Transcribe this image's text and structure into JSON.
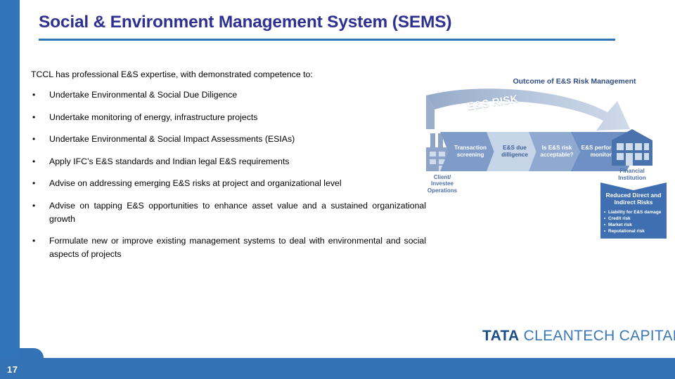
{
  "slide": {
    "title": "Social & Environment Management System (SEMS)",
    "page_number": "17",
    "accent_color": "#3274b8",
    "title_color": "#2e3192",
    "rule_color": "#2e75b6"
  },
  "body": {
    "lead": "TCCL has professional E&S expertise, with demonstrated competence to:",
    "bullet_marker": "•",
    "bullets": [
      "Undertake Environmental & Social Due Diligence",
      "Undertake monitoring of energy, infrastructure projects",
      "Undertake Environmental & Social Impact Assessments (ESIAs)",
      "Apply IFC’s E&S standards and Indian legal E&S requirements",
      "Advise on addressing emerging E&S risks at project and organizational level",
      "Advise on tapping E&S opportunities to enhance asset value and a sustained organizational growth",
      "Formulate new or improve existing management systems to deal with environmental and social aspects of projects"
    ]
  },
  "diagram": {
    "heading": "Outcome of E&S Risk Management",
    "arrow_label": "E&S RISK",
    "factory_label": "Client/\nInvestee\nOperations",
    "factory_label_lines": [
      "Client/",
      "Investee",
      "Operations"
    ],
    "stages": [
      "Transaction screening",
      "E&S due dilligence",
      "Is E&S risk acceptable?",
      "E&S performance monitoring"
    ],
    "bank_label_lines": [
      "Financial",
      "Institution"
    ],
    "outcome": {
      "title": "Reduced Direct and Indirect Risks",
      "items": [
        "Liability for E&S damage",
        "Credit risk",
        "Market risk",
        "Reputational risk"
      ]
    }
  },
  "logo": {
    "brand": "TATA",
    "name": "CLEANTECH CAPITAL"
  }
}
